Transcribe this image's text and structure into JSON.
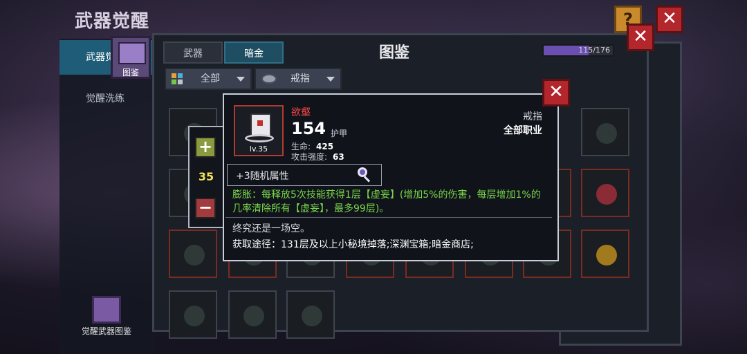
{
  "screen_title": "武器觉醒",
  "sidebar": {
    "items": [
      {
        "label": "武器觉"
      },
      {
        "label": "觉醒洗练"
      }
    ],
    "bottom_label": "觉醒武器图鉴"
  },
  "book_icon_label": "图鉴",
  "panel": {
    "tabs": [
      "武器",
      "暗金"
    ],
    "title": "图鉴",
    "progress": {
      "text": "115/176",
      "current": 115,
      "total": 176
    },
    "filters": [
      {
        "label": "全部"
      },
      {
        "label": "戒指"
      }
    ]
  },
  "stepper": {
    "value": "35"
  },
  "detail": {
    "name": "欲壑",
    "level": "lv.35",
    "armor": "154",
    "armor_label": "护甲",
    "stats": [
      {
        "label": "生命:",
        "value": "425"
      },
      {
        "label": "攻击强度:",
        "value": "63"
      }
    ],
    "type": "戒指",
    "class": "全部职业",
    "random_attr": "+3随机属性",
    "effect": "膨胀：每释放5次技能获得1层【虚妄】(增加5%的伤害，每层增加1%的几率清除所有【虚妄】，最多99层)。",
    "flavor": "终究还是一场空。",
    "source": "获取途径：131层及以上小秘境掉落;深渊宝箱;暗金商店;"
  },
  "colors": {
    "accent_tab": "#1f5c77",
    "close_red": "#b3262c",
    "rarity_red": "#ff4a4a",
    "effect_green": "#79d64a"
  }
}
